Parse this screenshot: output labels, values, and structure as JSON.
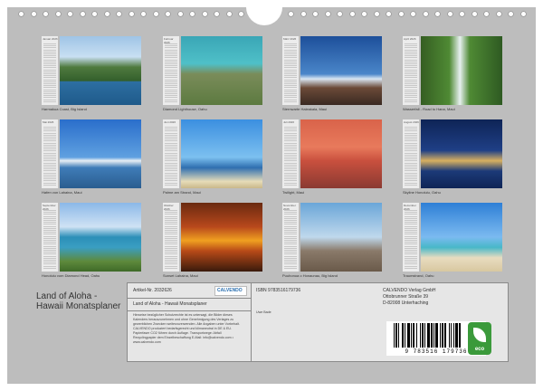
{
  "months": [
    {
      "month": "Januar 2026",
      "caption": "Harmakua Coast, Big Island"
    },
    {
      "month": "Februar 2026",
      "caption": "Diamond Lighthouse, Oahu"
    },
    {
      "month": "März 2026",
      "caption": "Sternwarte Haleakala, Maui"
    },
    {
      "month": "April 2026",
      "caption": "Wasserfall - Road to Hana, Maui"
    },
    {
      "month": "Mai 2026",
      "caption": "Hafen von Lahaina, Maui"
    },
    {
      "month": "Juni 2026",
      "caption": "Palme am Strand, Maui"
    },
    {
      "month": "Juli 2026",
      "caption": "Twilight, Maui"
    },
    {
      "month": "August 2026",
      "caption": "Skyline Honolulu, Oahu"
    },
    {
      "month": "September 2026",
      "caption": "Honolulu vom Diamond Head, Oahu"
    },
    {
      "month": "Oktober 2026",
      "caption": "Sunset Lahaina, Maui"
    },
    {
      "month": "November 2026",
      "caption": "Puuhonua o Honaunau, Big Island"
    },
    {
      "month": "Dezember 2026",
      "caption": "Traumstrand, Oahu"
    }
  ],
  "title": {
    "line1": "Land of Aloha -",
    "line2": "Hawaii Monatsplaner"
  },
  "info": {
    "article": "Artikel-Nr. 2032626",
    "brand": "CALVENDO",
    "subtitle": "Land of Aloha - Hawaii Monatsplaner",
    "legal": "Hinweise bezüglicher Schutzrechte ist es untersagt, die Bilder dieses Kalenders herauszunehmen und ohne Genehmigung des Verlages zu gewerblichen Zwecken weiterzuverwenden. Alle Angaben unter Vorbehalt. CALVENDO produziert bedarfsgerecht und klimaneutral in DE & EU. Papierfaser CO2 führen durch Auflage. Transportwege: Abfall Recyclingpapier dem Einzelbeschaffung E-Mail: info@calvendo.com • www.calvendo.com",
    "isbn": "ISBN 9783516179736",
    "users": "Uwe Bade",
    "publisher_line1": "CALVENDO Verlag GmbH",
    "publisher_line2": "Ottobrunner Straße 39",
    "publisher_line3": "D-82008 Unterhaching",
    "barcode": "9 783516 179736",
    "eco_label": "eco"
  }
}
